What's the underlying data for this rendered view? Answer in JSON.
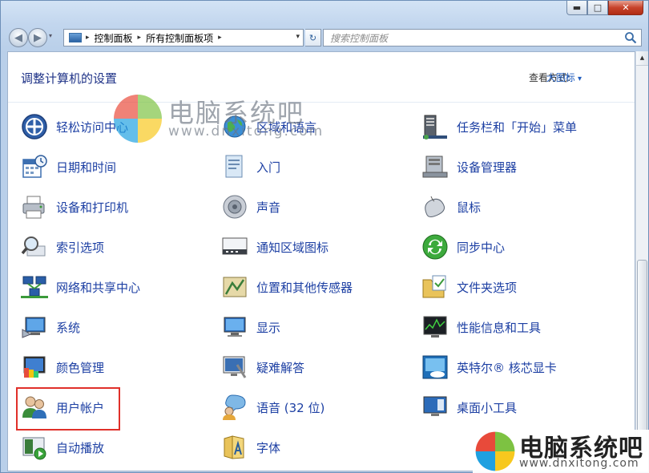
{
  "window": {
    "minimize": "▬",
    "maximize": "□",
    "close": "✕"
  },
  "nav": {
    "back": "◀",
    "forward": "▶",
    "history_dropdown": "▾",
    "breadcrumb": [
      "控制面板",
      "所有控制面板项"
    ],
    "breadcrumb_sep": "▸",
    "address_dropdown": "▾",
    "refresh": "↻",
    "search_placeholder": "搜索控制面板"
  },
  "header": {
    "title": "调整计算机的设置",
    "view_by_label": "查看方式:",
    "view_by_value": "大图标"
  },
  "items": {
    "col1": [
      "轻松访问中心",
      "日期和时间",
      "设备和打印机",
      "索引选项",
      "网络和共享中心",
      "系统",
      "颜色管理",
      "用户帐户",
      "自动播放"
    ],
    "col2": [
      "区域和语言",
      "入门",
      "声音",
      "通知区域图标",
      "位置和其他传感器",
      "显示",
      "疑难解答",
      "语音 (32 位)",
      "字体"
    ],
    "col3": [
      "任务栏和「开始」菜单",
      "设备管理器",
      "鼠标",
      "同步中心",
      "文件夹选项",
      "性能信息和工具",
      "英特尔® 核芯显卡",
      "桌面小工具"
    ]
  },
  "watermark": {
    "brand": "电脑系统吧",
    "url": "www.dnxitong.com"
  },
  "colors": {
    "link": "#1c3fa3",
    "title": "#1e3287",
    "highlight": "#e0302a"
  }
}
